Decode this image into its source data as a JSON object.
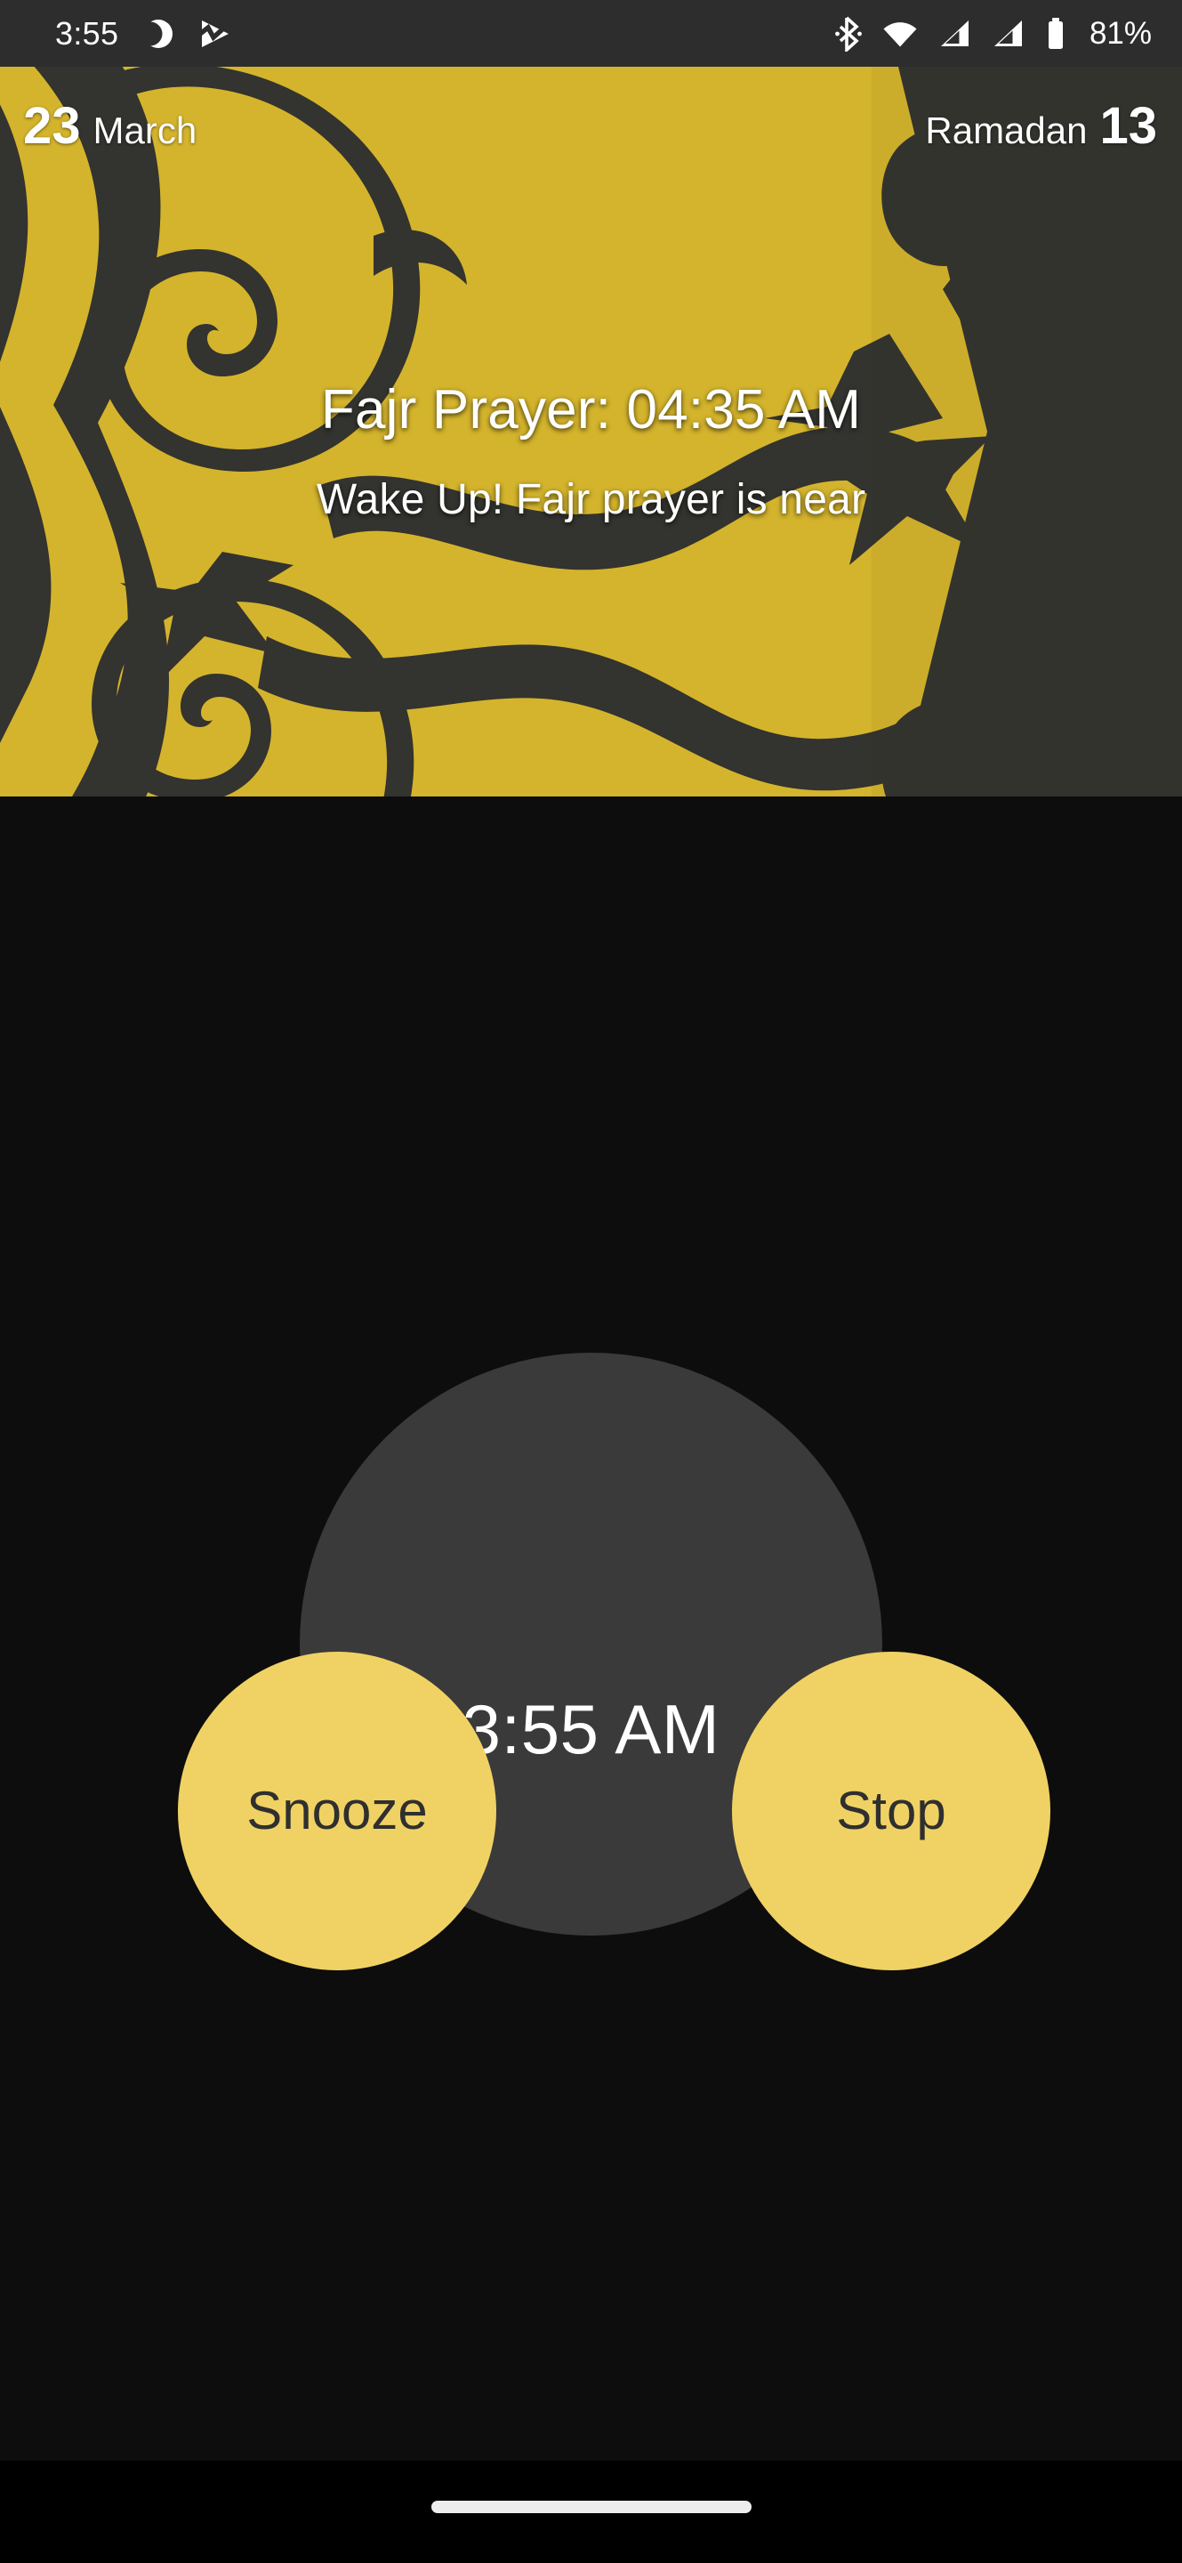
{
  "status_bar": {
    "clock": "3:55",
    "battery_percent": "81%",
    "left_icons": [
      "dnd-moon-icon",
      "media-play-icon"
    ],
    "right_icons": [
      "bluetooth-icon",
      "wifi-icon",
      "signal-sim1-icon",
      "signal-sim2-icon",
      "battery-icon"
    ],
    "background_color": "#2d2d2d"
  },
  "banner": {
    "gregorian_day": "23",
    "gregorian_month": "March",
    "hijri_month": "Ramadan",
    "hijri_day": "13",
    "prayer_title": "Fajr Prayer: 04:35 AM",
    "prayer_subtitle": "Wake Up! Fajr prayer is near",
    "background_color": "#33332f",
    "ornament_color": "#d4b42c",
    "ornament_name": "islamic-arabesque-pattern"
  },
  "alarm": {
    "current_time": "3:55 AM",
    "dial_color": "#3a3a3a",
    "background_color": "#0d0d0d",
    "buttons": [
      {
        "id": "snooze",
        "label": "Snooze",
        "color": "#f0d264",
        "text_color": "#2f2f2f"
      },
      {
        "id": "stop",
        "label": "Stop",
        "color": "#f0d264",
        "text_color": "#2f2f2f"
      }
    ]
  },
  "nav_bar": {
    "handle_name": "home-gesture-pill",
    "background_color": "#000000"
  }
}
